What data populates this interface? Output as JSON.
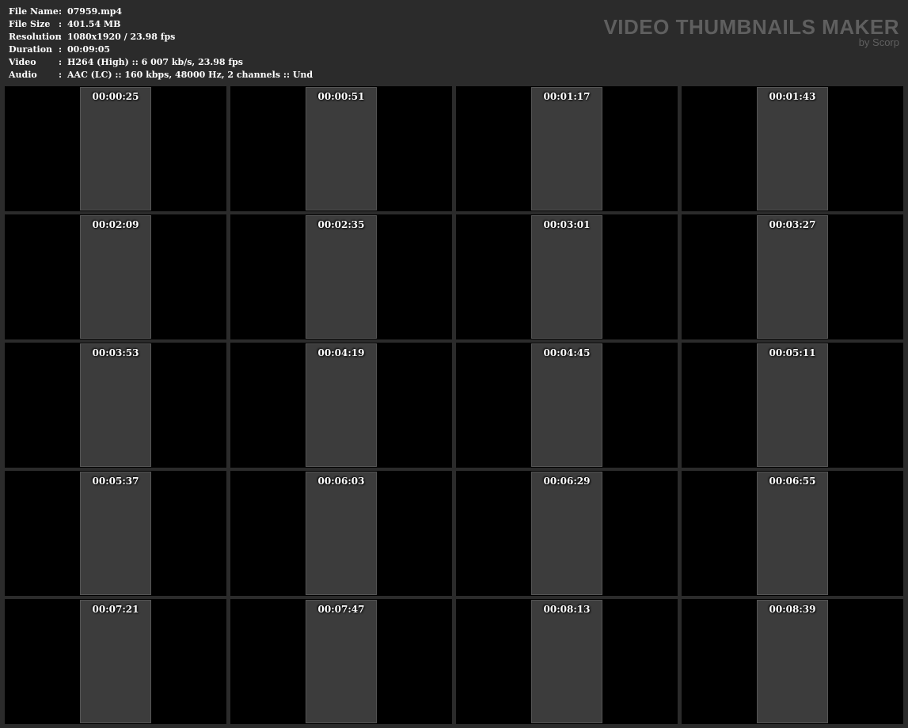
{
  "file_info": [
    {
      "label": "File Name",
      "sep": ":",
      "value": "07959.mp4"
    },
    {
      "label": "File Size",
      "sep": ":",
      "value": "401.54 MB"
    },
    {
      "label": "Resolution",
      "sep": ":",
      "value": "1080x1920 / 23.98 fps"
    },
    {
      "label": "Duration",
      "sep": ":",
      "value": "00:09:05"
    },
    {
      "label": "Video",
      "sep": ":",
      "value": "H264 (High) :: 6 007 kb/s, 23.98 fps"
    },
    {
      "label": "Audio",
      "sep": ":",
      "value": "AAC (LC) :: 160 kbps, 48000 Hz, 2 channels :: Und"
    }
  ],
  "brand": {
    "title": "VIDEO THUMBNAILS MAKER",
    "by": "by Scorp"
  },
  "thumbnails": [
    "00:00:25",
    "00:00:51",
    "00:01:17",
    "00:01:43",
    "00:02:09",
    "00:02:35",
    "00:03:01",
    "00:03:27",
    "00:03:53",
    "00:04:19",
    "00:04:45",
    "00:05:11",
    "00:05:37",
    "00:06:03",
    "00:06:29",
    "00:06:55",
    "00:07:21",
    "00:07:47",
    "00:08:13",
    "00:08:39"
  ]
}
